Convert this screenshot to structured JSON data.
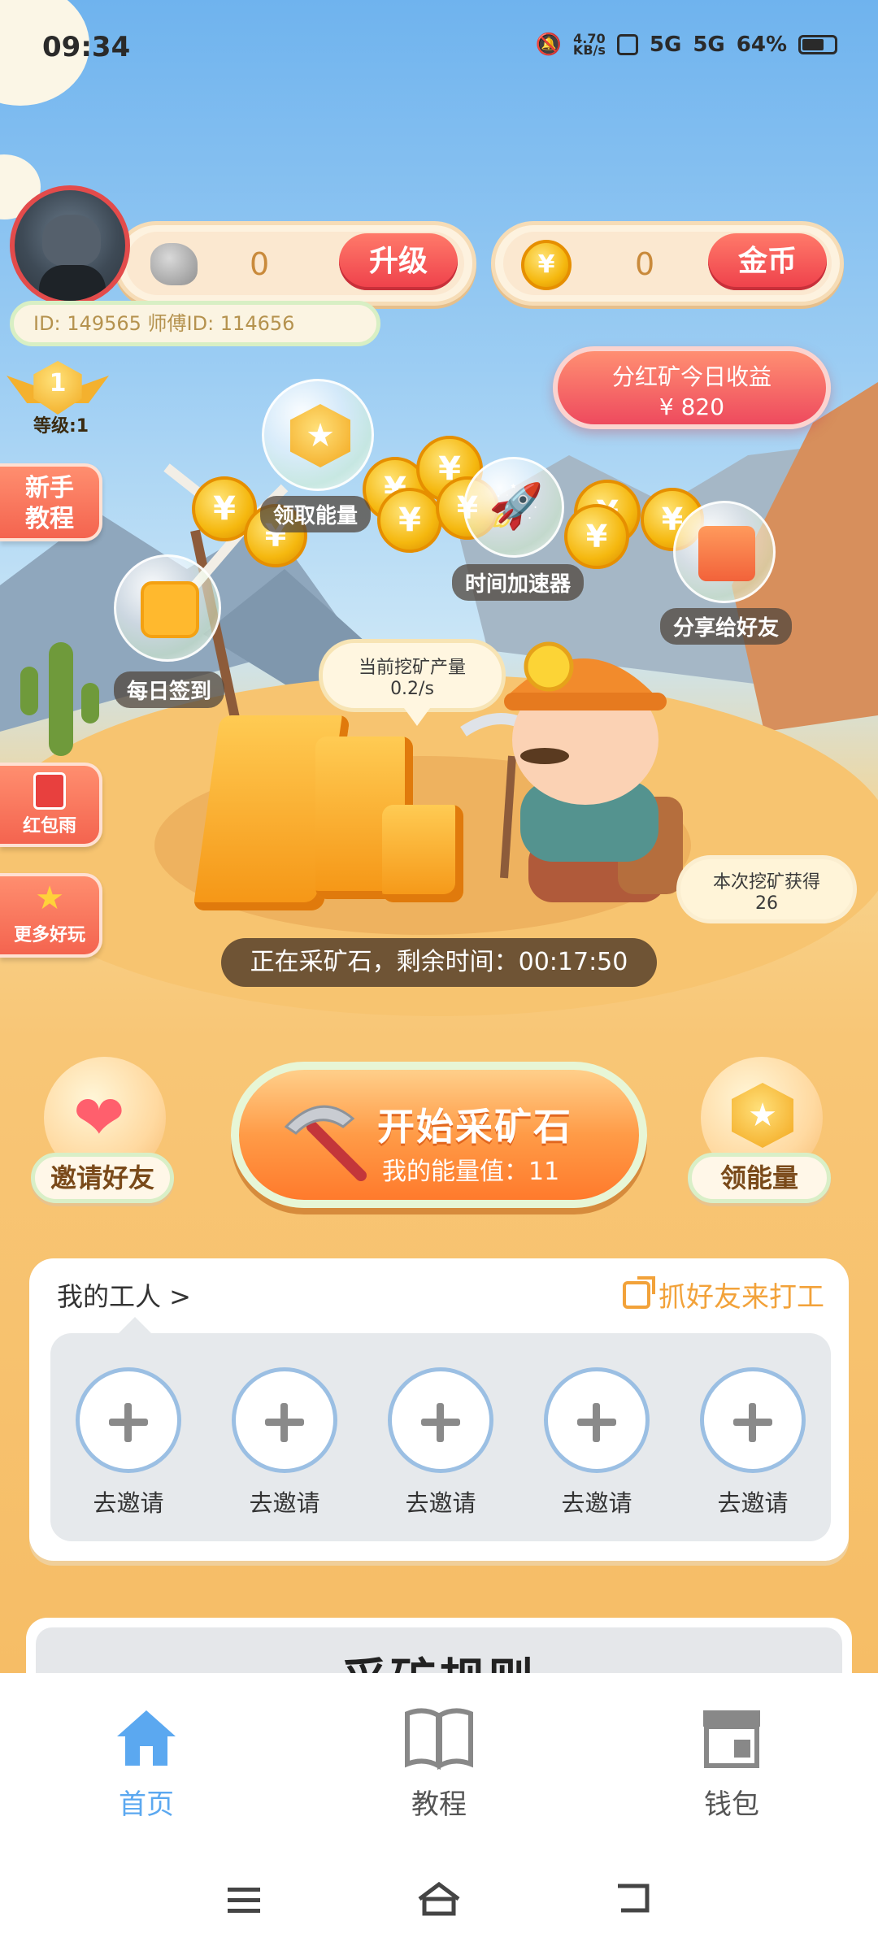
{
  "status_bar": {
    "time": "09:34",
    "net_speed": "4.70",
    "net_unit": "KB/s",
    "net1": "5G",
    "net2": "5G",
    "battery": "64%"
  },
  "wallet": {
    "stone_count": "0",
    "upgrade_label": "升级",
    "coin_count": "0",
    "coin_label": "金币",
    "coin_symbol": "¥"
  },
  "user": {
    "ids": "ID: 149565  师傅ID: 114656",
    "level_number": "1",
    "level_label": "等级:1"
  },
  "profit": {
    "title": "分红矿今日收益",
    "amount": "¥ 820"
  },
  "side_buttons": {
    "tutorial": "新手\n教程",
    "red_packet": "红包雨",
    "more_games": "更多好玩"
  },
  "bubbles": {
    "energy": "领取能量",
    "accelerator": "时间加速器",
    "share": "分享给好友",
    "checkin": "每日签到"
  },
  "mining": {
    "rate_label": "当前挖矿产量",
    "rate_value": "0.2/s",
    "gain_label": "本次挖矿获得",
    "gain_value": "26",
    "timer": "正在采矿石，剩余时间：00:17:50"
  },
  "actions": {
    "invite_friends": "邀请好友",
    "start_title": "开始采矿石",
    "energy_value": "我的能量值：11",
    "get_energy": "领能量"
  },
  "workers": {
    "title": "我的工人 >",
    "invite_link": "抓好友来打工",
    "slots": [
      "去邀请",
      "去邀请",
      "去邀请",
      "去邀请",
      "去邀请"
    ]
  },
  "rules": {
    "title": "采矿规则"
  },
  "bottom_nav": {
    "home": "首页",
    "tutorial": "教程",
    "wallet": "钱包",
    "active_color": "#5ba8f0",
    "inactive_color": "#555555"
  }
}
